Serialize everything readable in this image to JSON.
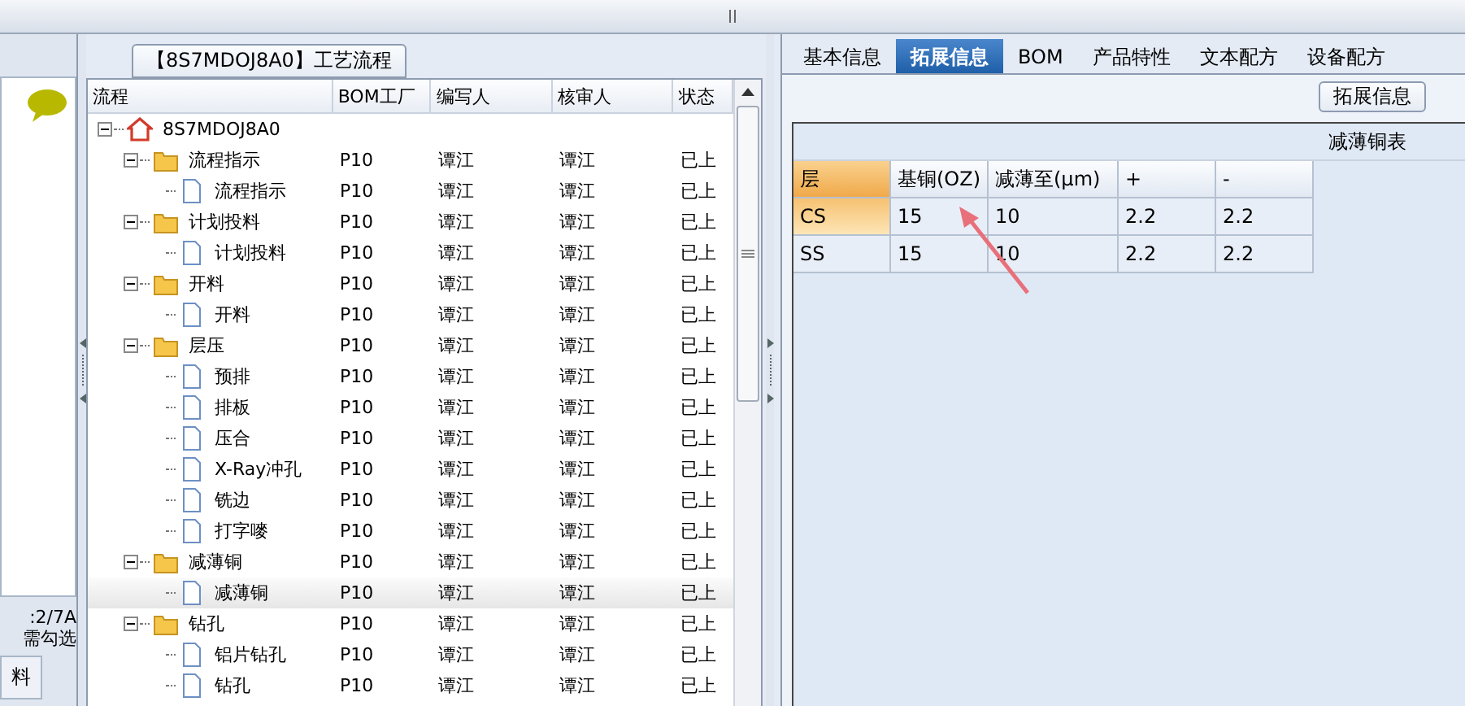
{
  "left_panel": {
    "status_lines": [
      ":2/7A",
      "需勾选"
    ],
    "tab": "料"
  },
  "process_panel": {
    "title": "【8S7MDOJ8A0】工艺流程",
    "columns": [
      "流程",
      "BOM工厂",
      "编写人",
      "核审人",
      "状态"
    ],
    "tree": [
      {
        "label": "8S7MDOJ8A0",
        "kind": "root",
        "expanded": true,
        "selected": false,
        "children": [
          {
            "label": "流程指示",
            "kind": "folder",
            "expanded": true,
            "selected": false,
            "factory": "P10",
            "author": "谭江",
            "reviewer": "谭江",
            "status": "已上",
            "children": [
              {
                "label": "流程指示",
                "kind": "leaf",
                "selected": false,
                "factory": "P10",
                "author": "谭江",
                "reviewer": "谭江",
                "status": "已上"
              }
            ]
          },
          {
            "label": "计划投料",
            "kind": "folder",
            "expanded": true,
            "selected": false,
            "factory": "P10",
            "author": "谭江",
            "reviewer": "谭江",
            "status": "已上",
            "children": [
              {
                "label": "计划投料",
                "kind": "leaf",
                "selected": false,
                "factory": "P10",
                "author": "谭江",
                "reviewer": "谭江",
                "status": "已上"
              }
            ]
          },
          {
            "label": "开料",
            "kind": "folder",
            "expanded": true,
            "selected": false,
            "factory": "P10",
            "author": "谭江",
            "reviewer": "谭江",
            "status": "已上",
            "children": [
              {
                "label": "开料",
                "kind": "leaf",
                "selected": false,
                "factory": "P10",
                "author": "谭江",
                "reviewer": "谭江",
                "status": "已上"
              }
            ]
          },
          {
            "label": "层压",
            "kind": "folder",
            "expanded": true,
            "selected": false,
            "factory": "P10",
            "author": "谭江",
            "reviewer": "谭江",
            "status": "已上",
            "children": [
              {
                "label": "预排",
                "kind": "leaf",
                "selected": false,
                "factory": "P10",
                "author": "谭江",
                "reviewer": "谭江",
                "status": "已上"
              },
              {
                "label": "排板",
                "kind": "leaf",
                "selected": false,
                "factory": "P10",
                "author": "谭江",
                "reviewer": "谭江",
                "status": "已上"
              },
              {
                "label": "压合",
                "kind": "leaf",
                "selected": false,
                "factory": "P10",
                "author": "谭江",
                "reviewer": "谭江",
                "status": "已上"
              },
              {
                "label": "X-Ray冲孔",
                "kind": "leaf",
                "selected": false,
                "factory": "P10",
                "author": "谭江",
                "reviewer": "谭江",
                "status": "已上"
              },
              {
                "label": "铣边",
                "kind": "leaf",
                "selected": false,
                "factory": "P10",
                "author": "谭江",
                "reviewer": "谭江",
                "status": "已上"
              },
              {
                "label": "打字嘜",
                "kind": "leaf",
                "selected": false,
                "factory": "P10",
                "author": "谭江",
                "reviewer": "谭江",
                "status": "已上"
              }
            ]
          },
          {
            "label": "减薄铜",
            "kind": "folder",
            "expanded": true,
            "selected": false,
            "factory": "P10",
            "author": "谭江",
            "reviewer": "谭江",
            "status": "已上",
            "children": [
              {
                "label": "减薄铜",
                "kind": "leaf",
                "selected": true,
                "factory": "P10",
                "author": "谭江",
                "reviewer": "谭江",
                "status": "已上"
              }
            ]
          },
          {
            "label": "钻孔",
            "kind": "folder",
            "expanded": true,
            "selected": false,
            "factory": "P10",
            "author": "谭江",
            "reviewer": "谭江",
            "status": "已上",
            "children": [
              {
                "label": "铝片钻孔",
                "kind": "leaf",
                "selected": false,
                "factory": "P10",
                "author": "谭江",
                "reviewer": "谭江",
                "status": "已上"
              },
              {
                "label": "钻孔",
                "kind": "leaf",
                "selected": false,
                "factory": "P10",
                "author": "谭江",
                "reviewer": "谭江",
                "status": "已上"
              }
            ]
          }
        ]
      }
    ]
  },
  "detail_panel": {
    "tabs": [
      {
        "label": "基本信息",
        "selected": false
      },
      {
        "label": "拓展信息",
        "selected": true
      },
      {
        "label": "BOM",
        "selected": false
      },
      {
        "label": "产品特性",
        "selected": false
      },
      {
        "label": "文本配方",
        "selected": false
      },
      {
        "label": "设备配方",
        "selected": false
      }
    ],
    "group_title": "拓展信息",
    "table": {
      "title": "减薄铜表",
      "columns": [
        "层",
        "基铜(OZ)",
        "减薄至(μm)",
        "+",
        "-"
      ],
      "rows": [
        {
          "cells": [
            "CS",
            "15",
            "10",
            "2.2",
            "2.2"
          ],
          "selected": true
        },
        {
          "cells": [
            "SS",
            "15",
            "10",
            "2.2",
            "2.2"
          ],
          "selected": false
        }
      ]
    }
  }
}
